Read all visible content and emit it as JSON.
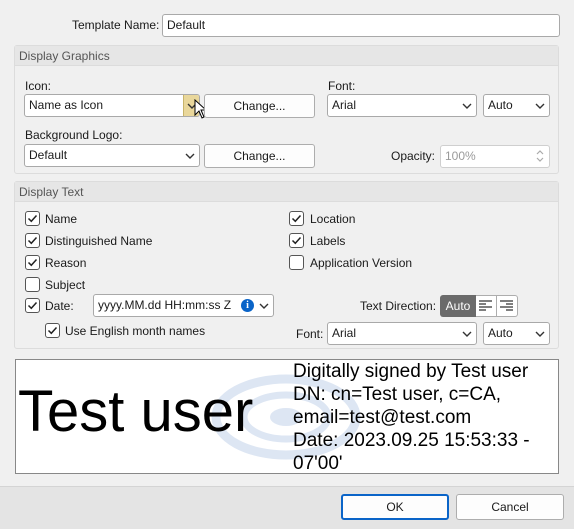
{
  "template_name": {
    "label": "Template Name:",
    "value": "Default"
  },
  "display_graphics": {
    "title": "Display Graphics",
    "icon_label": "Icon:",
    "icon_value": "Name as Icon",
    "icon_change": "Change...",
    "font_label": "Font:",
    "font_value": "Arial",
    "font_size": "Auto",
    "bg_logo_label": "Background Logo:",
    "bg_logo_value": "Default",
    "bg_logo_change": "Change...",
    "opacity_label": "Opacity:",
    "opacity_value": "100%"
  },
  "display_text": {
    "title": "Display Text",
    "name": {
      "label": "Name",
      "checked": true
    },
    "distinguished_name": {
      "label": "Distinguished Name",
      "checked": true
    },
    "reason": {
      "label": "Reason",
      "checked": true
    },
    "subject": {
      "label": "Subject",
      "checked": false
    },
    "date": {
      "label": "Date:",
      "checked": true,
      "format": "yyyy.MM.dd HH:mm:ss Z"
    },
    "english_months": {
      "label": "Use English month names",
      "checked": true
    },
    "location": {
      "label": "Location",
      "checked": true
    },
    "labels": {
      "label": "Labels",
      "checked": true
    },
    "app_version": {
      "label": "Application Version",
      "checked": false
    },
    "text_direction_label": "Text Direction:",
    "text_direction_auto": "Auto",
    "font_label": "Font:",
    "font_value": "Arial",
    "font_size": "Auto"
  },
  "preview": {
    "name": "Test user",
    "line1": "Digitally signed by Test user",
    "line2": "DN: cn=Test user, c=CA,",
    "line3": "email=test@test.com",
    "line4": "Date: 2023.09.25 15:53:33 -",
    "line5": "07'00'"
  },
  "buttons": {
    "ok": "OK",
    "cancel": "Cancel"
  },
  "colors": {
    "accent": "#0a64c8",
    "toggle_active": "#6b6b6b",
    "dropdown_hover": "#e9d79b"
  }
}
